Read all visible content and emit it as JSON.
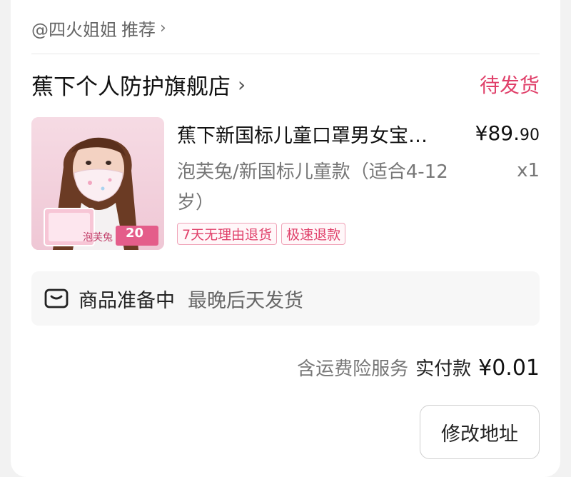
{
  "recommendation": {
    "user": "@四火姐姐",
    "action": "推荐",
    "chevron": "›"
  },
  "shop": {
    "name": "蕉下个人防护旗舰店",
    "chevron": "›",
    "status": "待发货",
    "status_color": "#e0406a"
  },
  "product": {
    "image_icon": "product-photo-girl-wearing-mask",
    "image_badge_text": "泡芙兔",
    "image_badge_count": "20",
    "title": "蕉下新国标儿童口罩男女宝…",
    "price_symbol": "¥",
    "price_main": "89.",
    "price_cents": "90",
    "spec": "泡芙兔/新国标儿童款（适合4-12岁）",
    "quantity": "x1",
    "tags": [
      "7天无理由退货",
      "极速退款"
    ]
  },
  "prep": {
    "icon": "package-box-icon",
    "title": "商品准备中",
    "note": "最晚后天发货"
  },
  "payment": {
    "insurance": "含运费险服务",
    "paid_label": "实付款",
    "paid_amount": "¥0.01"
  },
  "actions": {
    "modify_address": "修改地址"
  }
}
